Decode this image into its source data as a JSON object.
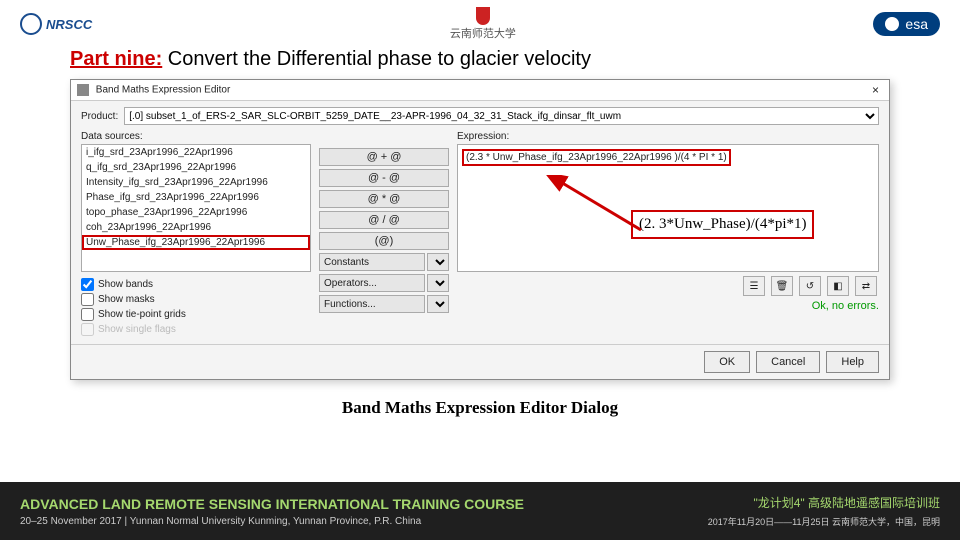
{
  "header": {
    "logo_left": "NRSCC",
    "logo_center": "云南师范大学",
    "logo_right": "esa"
  },
  "title": {
    "part": "Part nine:",
    "rest": " Convert the Differential phase to glacier velocity"
  },
  "dialog": {
    "window_title": "Band Maths Expression Editor",
    "close": "×",
    "product_label": "Product:",
    "product_value": "[.0] subset_1_of_ERS-2_SAR_SLC-ORBIT_5259_DATE__23-APR-1996_04_32_31_Stack_ifg_dinsar_flt_uwm",
    "data_sources_label": "Data sources:",
    "data_sources": [
      "i_ifg_srd_23Apr1996_22Apr1996",
      "q_ifg_srd_23Apr1996_22Apr1996",
      "Intensity_ifg_srd_23Apr1996_22Apr1996",
      "Phase_ifg_srd_23Apr1996_22Apr1996",
      "topo_phase_23Apr1996_22Apr1996",
      "coh_23Apr1996_22Apr1996",
      "Unw_Phase_ifg_23Apr1996_22Apr1996"
    ],
    "selected_source_index": 6,
    "ops": {
      "add": "@ + @",
      "sub": "@ - @",
      "mul": "@ * @",
      "div": "@ / @",
      "paren": "(@)",
      "constants": "Constants",
      "operators": "Operators...",
      "functions": "Functions..."
    },
    "expression_label": "Expression:",
    "expression_value": "(2.3 * Unw_Phase_ifg_23Apr1996_22Apr1996 )/(4 * PI * 1)",
    "checks": {
      "bands": "Show bands",
      "masks": "Show masks",
      "grids": "Show tie-point grids",
      "flags": "Show single flags"
    },
    "toolbar": {
      "history": "☰",
      "clear": "🗑",
      "undo": "↺",
      "target": "◧",
      "swap": "⇄"
    },
    "status": "Ok, no errors.",
    "buttons": {
      "ok": "OK",
      "cancel": "Cancel",
      "help": "Help"
    }
  },
  "formula_callout": "(2. 3*Unw_Phase)/(4*pi*1)",
  "caption": "Band Maths Expression Editor Dialog",
  "footer": {
    "left_title": "ADVANCED LAND REMOTE SENSING INTERNATIONAL TRAINING COURSE",
    "left_sub": "20–25 November 2017 | Yunnan Normal University Kunming, Yunnan Province, P.R. China",
    "right_title": "\"龙计划4\" 高级陆地遥感国际培训班",
    "right_sub": "2017年11月20日——11月25日 云南师范大学，中国，昆明"
  }
}
